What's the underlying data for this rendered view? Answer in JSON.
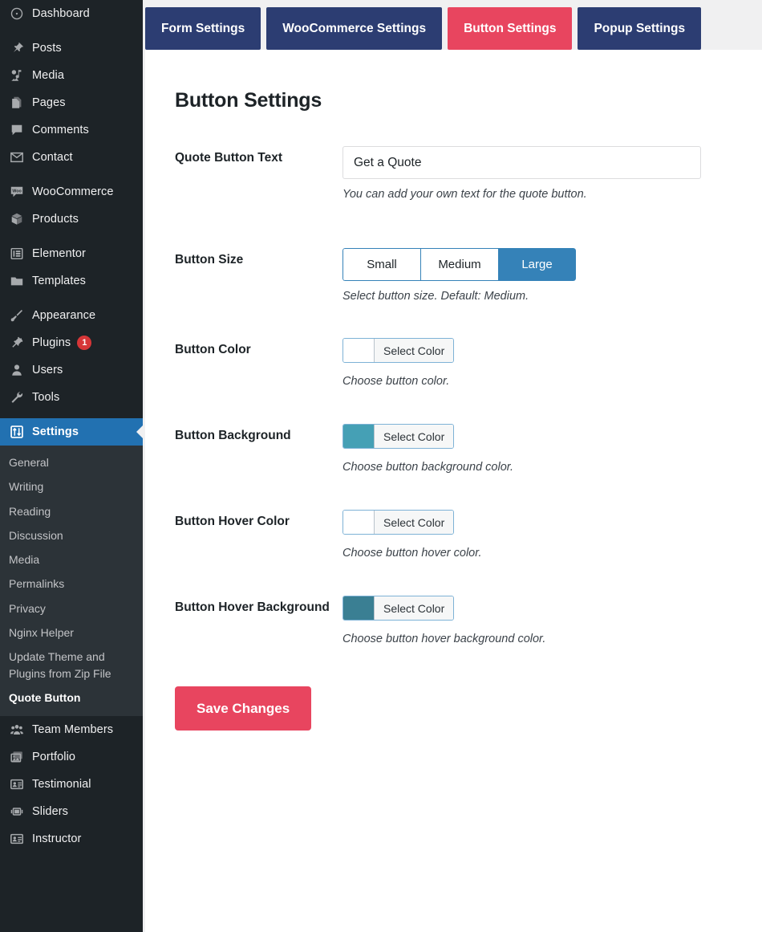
{
  "sidebar": {
    "items": [
      {
        "label": "Dashboard",
        "icon": "dashboard-icon"
      },
      {
        "label": "Posts",
        "icon": "pin-icon"
      },
      {
        "label": "Media",
        "icon": "media-icon"
      },
      {
        "label": "Pages",
        "icon": "pages-icon"
      },
      {
        "label": "Comments",
        "icon": "comments-icon"
      },
      {
        "label": "Contact",
        "icon": "envelope-icon"
      },
      {
        "label": "WooCommerce",
        "icon": "woocommerce-icon"
      },
      {
        "label": "Products",
        "icon": "products-box-icon"
      },
      {
        "label": "Elementor",
        "icon": "elementor-icon"
      },
      {
        "label": "Templates",
        "icon": "folder-icon"
      },
      {
        "label": "Appearance",
        "icon": "paintbrush-icon"
      },
      {
        "label": "Plugins",
        "icon": "plug-icon",
        "badge": "1"
      },
      {
        "label": "Users",
        "icon": "user-icon"
      },
      {
        "label": "Tools",
        "icon": "wrench-icon"
      },
      {
        "label": "Settings",
        "icon": "settings-sliders-icon",
        "active": true
      }
    ],
    "submenu": [
      {
        "label": "General"
      },
      {
        "label": "Writing"
      },
      {
        "label": "Reading"
      },
      {
        "label": "Discussion"
      },
      {
        "label": "Media"
      },
      {
        "label": "Permalinks"
      },
      {
        "label": "Privacy"
      },
      {
        "label": "Nginx Helper"
      },
      {
        "label": "Update Theme and Plugins from Zip File"
      },
      {
        "label": "Quote Button",
        "current": true
      }
    ],
    "items_after": [
      {
        "label": "Team Members",
        "icon": "team-icon"
      },
      {
        "label": "Portfolio",
        "icon": "portfolio-images-icon"
      },
      {
        "label": "Testimonial",
        "icon": "testimonial-card-icon"
      },
      {
        "label": "Sliders",
        "icon": "slider-icon"
      },
      {
        "label": "Instructor",
        "icon": "instructor-card-icon"
      }
    ]
  },
  "tabs": [
    {
      "label": "Form Settings",
      "active": false
    },
    {
      "label": "WooCommerce Settings",
      "active": false
    },
    {
      "label": "Button Settings",
      "active": true
    },
    {
      "label": "Popup Settings",
      "active": false
    }
  ],
  "page": {
    "title": "Button Settings"
  },
  "fields": {
    "quote_button_text": {
      "label": "Quote Button Text",
      "value": "Get a Quote",
      "placeholder": "",
      "description": "You can add your own text for the quote button."
    },
    "button_size": {
      "label": "Button Size",
      "options": [
        "Small",
        "Medium",
        "Large"
      ],
      "selected": "Large",
      "description": "Select button size. Default: Medium."
    },
    "button_color": {
      "label": "Button Color",
      "button_label": "Select Color",
      "swatch": "#ffffff",
      "description": "Choose button color."
    },
    "button_background": {
      "label": "Button Background",
      "button_label": "Select Color",
      "swatch": "#45a0b5",
      "description": "Choose button background color."
    },
    "button_hover_color": {
      "label": "Button Hover Color",
      "button_label": "Select Color",
      "swatch": "#ffffff",
      "description": "Choose button hover color."
    },
    "button_hover_background": {
      "label": "Button Hover Background",
      "button_label": "Select Color",
      "swatch": "#3a7f93",
      "description": "Choose button hover background color."
    }
  },
  "actions": {
    "save_label": "Save Changes"
  },
  "colors": {
    "tab_navy": "#2c3d72",
    "tab_active_red": "#e8455f",
    "sidebar_bg": "#1d2327",
    "sidebar_active_blue": "#2271b1",
    "badge_red": "#d63638",
    "segment_blue": "#3582b8"
  }
}
